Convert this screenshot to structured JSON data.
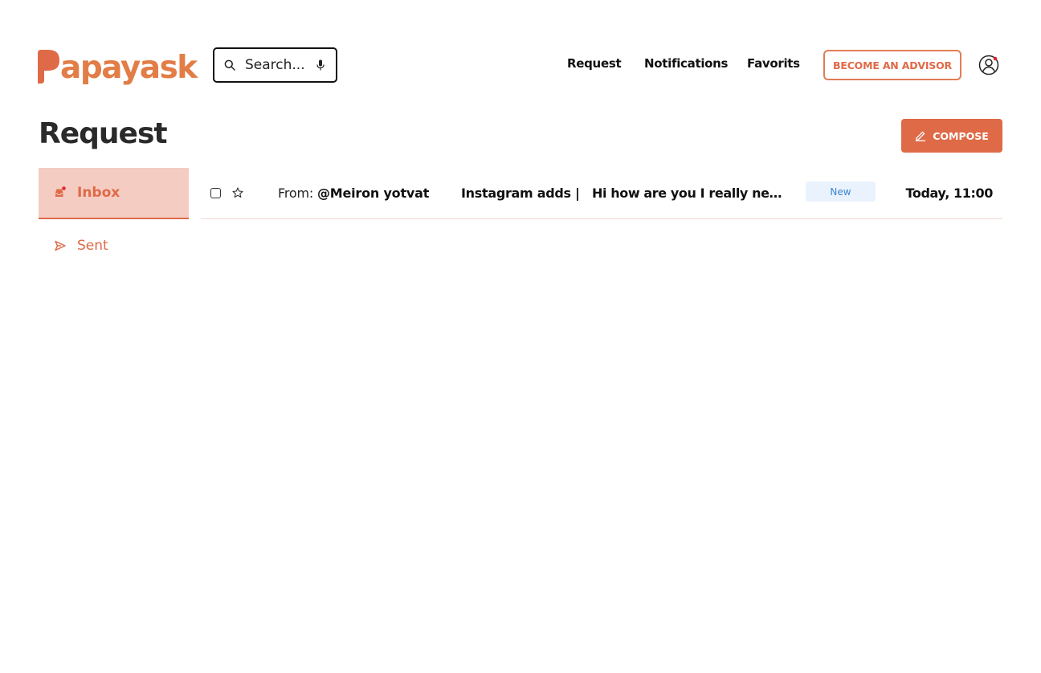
{
  "brand": {
    "logo_letter": "P",
    "logo_text": "apayask",
    "accent_color": "#df6a47",
    "logo_color": "#e27d47"
  },
  "search": {
    "placeholder": "Search...",
    "icon": "search-icon",
    "mic_icon": "microphone-icon"
  },
  "nav": {
    "request": "Request",
    "notifications": "Notifications",
    "favorits": "Favorits",
    "advisor_button": "BECOME AN ADVISOR",
    "profile_icon": "user-circle-icon"
  },
  "page": {
    "title": "Request",
    "compose_label": "COMPOSE",
    "compose_icon": "pencil-icon"
  },
  "sidebar": {
    "items": [
      {
        "label": "Inbox",
        "icon": "inbox-icon",
        "active": true
      },
      {
        "label": "Sent",
        "icon": "send-icon",
        "active": false
      }
    ]
  },
  "messages": [
    {
      "from_prefix": "From:",
      "from_name": "@Meiron yotvat",
      "subject": "Instagram adds |",
      "preview": "Hi how are you I really need help with",
      "badge": "New",
      "time": "Today, 11:00",
      "badge_color": "#3a86d3"
    }
  ]
}
